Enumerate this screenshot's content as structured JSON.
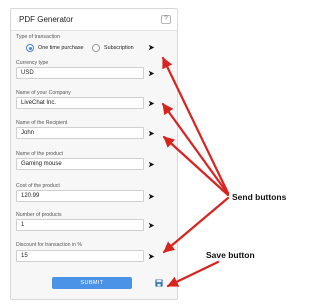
{
  "panel": {
    "title": "PDF Generator",
    "help_label": "?"
  },
  "transaction": {
    "label": "Type of transaction",
    "options": [
      {
        "label": "One time purchase",
        "selected": true
      },
      {
        "label": "Subscription",
        "selected": false
      }
    ]
  },
  "fields": [
    {
      "label": "Currency type",
      "value": "USD"
    },
    {
      "label": "Name of your Company",
      "value": "LiveChat Inc."
    },
    {
      "label": "Name of the Recipient",
      "value": "John"
    },
    {
      "label": "Name of the product",
      "value": "Gaming mouse"
    },
    {
      "label": "Cost of the product",
      "value": "120.99"
    },
    {
      "label": "Number of products",
      "value": "1"
    },
    {
      "label": "Discount for transaction in %",
      "value": "15"
    }
  ],
  "submit_label": "SUBMIT",
  "annotations": {
    "send_buttons": "Send buttons",
    "save_button": "Save button"
  },
  "colors": {
    "accent": "#4a93e6",
    "arrow": "#d9231f",
    "panel_bg": "#f7f7f7"
  },
  "icons": {
    "send": "send-icon",
    "save": "floppy-disk-icon"
  }
}
